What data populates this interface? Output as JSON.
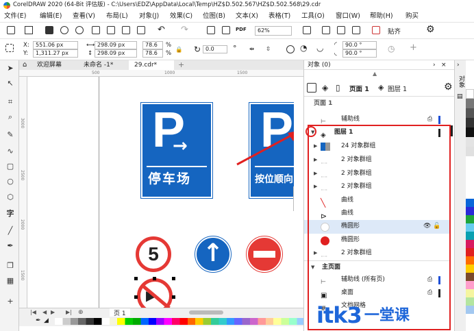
{
  "window": {
    "title": "CorelDRAW 2020 (64-Bit 评估版) - C:\\Users\\EDZ\\AppData\\Local\\Temp\\HZ$D.502.567\\HZ$D.502.568\\29.cdr"
  },
  "menu": [
    "文件(E)",
    "编辑(E)",
    "查看(V)",
    "布局(L)",
    "对象(J)",
    "效果(C)",
    "位图(B)",
    "文本(X)",
    "表格(T)",
    "工具(O)",
    "窗口(W)",
    "帮助(H)",
    "购买"
  ],
  "toolbar": {
    "zoom": "62%",
    "paste_mode": "贴齐"
  },
  "props": {
    "x_label": "X:",
    "y_label": "Y:",
    "x": "551.06 px",
    "y": "1,311.27 px",
    "w": "298.09 px",
    "h": "298.09 px",
    "sx": "78.6",
    "sy": "78.6",
    "pct": "%",
    "rot": "0.0",
    "ang1": "90.0 °",
    "ang2": "90.0 °"
  },
  "doc_tabs": [
    "欢迎屏幕",
    "未命名 -1*",
    "29.cdr*"
  ],
  "ruler": {
    "h_ticks": [
      "500",
      "1000",
      "1500"
    ],
    "v_ticks": [
      "3000",
      "2500",
      "2000",
      "1500"
    ]
  },
  "signs": {
    "sign1_letter": "P",
    "sign1_arrow": "→",
    "sign1_text": "停车场",
    "sign2_letter": "P",
    "sign2_text": "按位顺向",
    "speed_limit": "5",
    "up_arrow": "↑"
  },
  "status": {
    "page_label": "页 1"
  },
  "objects_panel": {
    "title": "对象 (0)",
    "page_label": "页面 1",
    "layer_label": "图层 1",
    "header_cut": "页面 1",
    "rows": [
      {
        "label": "辅助线",
        "indent": 1
      },
      {
        "label": "图层 1",
        "indent": 1,
        "bold": true
      },
      {
        "label": "24 对象群组",
        "indent": 2
      },
      {
        "label": "2 对象群组",
        "indent": 2
      },
      {
        "label": "2 对象群组",
        "indent": 2
      },
      {
        "label": "2 对象群组",
        "indent": 2
      },
      {
        "label": "曲线",
        "indent": 2
      },
      {
        "label": "曲线",
        "indent": 2
      },
      {
        "label": "椭圆形",
        "indent": 2,
        "selected": true
      },
      {
        "label": "椭圆形",
        "indent": 2
      },
      {
        "label": "2 对象群组",
        "indent": 2
      }
    ],
    "master_label": "主页面",
    "master_rows": [
      "辅助线 (所有页)",
      "桌面",
      "文档网格"
    ]
  },
  "right_dock": {
    "label": "对象"
  },
  "watermark": {
    "text": "itk3",
    "sub": "一堂课"
  },
  "colors": {
    "accent_red": "#e02020",
    "sign_blue": "#1565c0"
  }
}
